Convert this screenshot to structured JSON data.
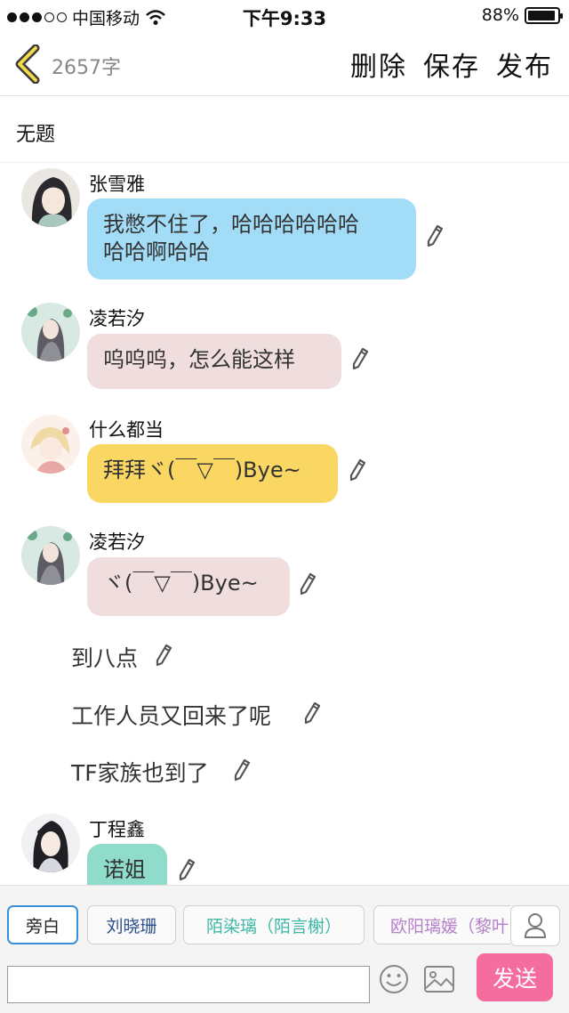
{
  "status_bar": {
    "carrier": "中国移动",
    "time": "下午9:33",
    "battery": "88%"
  },
  "nav": {
    "word_count": "2657字",
    "actions": [
      "删除",
      "保存",
      "发布"
    ]
  },
  "title": "无题",
  "messages": [
    {
      "sender": "张雪雅",
      "lines": [
        "我憋不住了，哈哈哈哈哈哈",
        "哈哈啊哈哈"
      ],
      "color": "#a3dcf7"
    },
    {
      "sender": "凌若汐",
      "lines": [
        "呜呜呜，怎么能这样"
      ],
      "color": "#f0dddd"
    },
    {
      "sender": "什么都当",
      "lines": [
        "拜拜ヾ(￣▽￣)Bye~"
      ],
      "color": "#fad763"
    },
    {
      "sender": "凌若汐",
      "lines": [
        "ヾ(￣▽￣)Bye~"
      ],
      "color": "#f0dddd"
    },
    {
      "sender": "丁程鑫",
      "lines": [
        "诺姐"
      ],
      "color": "#8fdccb"
    }
  ],
  "narrations": [
    "到八点",
    "工作人员又回来了呢",
    "TF家族也到了"
  ],
  "role_tabs": [
    {
      "label": "旁白",
      "color": "#222222"
    },
    {
      "label": "刘晓珊",
      "color": "#2d4f8c"
    },
    {
      "label": "陌染璃（陌言榭）",
      "color": "#3fb9a6"
    },
    {
      "label": "欧阳璃媛（黎叶",
      "color": "#b580c9"
    }
  ],
  "input": {
    "placeholder": "",
    "send_label": "发送"
  },
  "icons": [
    "back-chevron-icon",
    "pencil-icon",
    "person-icon",
    "emoji-icon",
    "image-icon"
  ]
}
